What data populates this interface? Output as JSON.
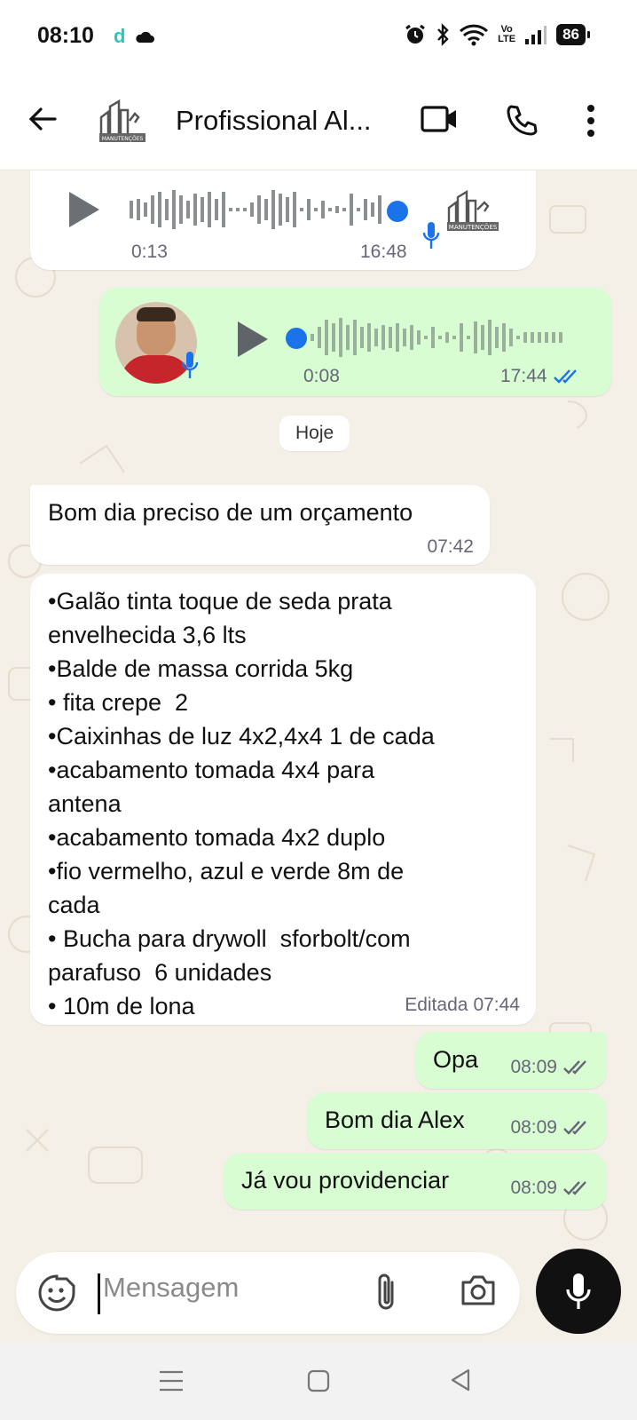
{
  "status_bar": {
    "time": "08:10",
    "notif_letter": "d",
    "volte": "Vo\nLTE",
    "battery": "86"
  },
  "header": {
    "contact_name": "Profissional Al...",
    "icons": [
      "back-arrow-icon",
      "contact-logo",
      "video-call-icon",
      "voice-call-icon",
      "more-vert-icon"
    ]
  },
  "messages": {
    "audio_in": {
      "elapsed": "0:13",
      "time": "16:48"
    },
    "audio_out": {
      "elapsed": "0:08",
      "time": "17:44"
    },
    "day_divider": "Hoje",
    "m1": {
      "text": "Bom dia preciso de um orçamento",
      "time": "07:42"
    },
    "m2": {
      "lines": [
        "•Galão tinta toque de seda prata",
        "envelhecida 3,6 lts",
        "•Balde de massa corrida 5kg",
        "• fita crepe  2",
        "•Caixinhas de luz 4x2,4x4 1 de cada",
        "•acabamento tomada 4x4 para",
        "antena",
        "•acabamento tomada 4x2 duplo",
        "•fio vermelho, azul e verde 8m de",
        "cada",
        "• Bucha para drywoll  sforbolt/com",
        "parafuso  6 unidades",
        "• 10m de lona"
      ],
      "edited": "Editada",
      "time": "07:44"
    },
    "m3": {
      "text": "Opa",
      "time": "08:09"
    },
    "m4": {
      "text": "Bom dia Alex",
      "time": "08:09"
    },
    "m5": {
      "text": "Já vou providenciar",
      "time": "08:09"
    }
  },
  "composer": {
    "placeholder": "Mensagem"
  },
  "colors": {
    "accent_blue": "#1a73e8",
    "out_bubble": "#d9fdd3",
    "tick_blue": "#53bdeb"
  }
}
